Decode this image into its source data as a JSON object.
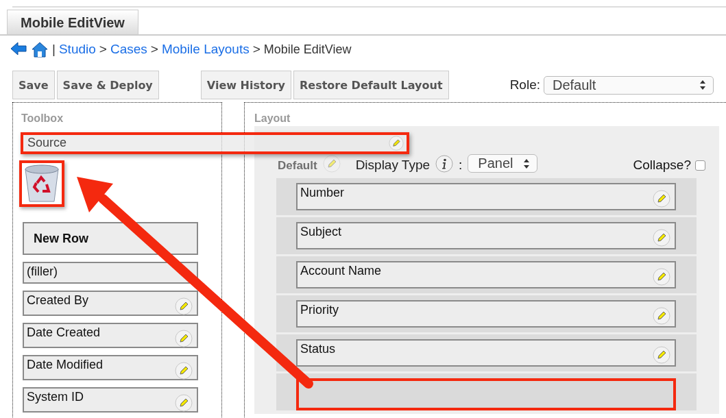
{
  "tab": {
    "label": "Mobile EditView",
    "selected": true
  },
  "breadcrumb": [
    {
      "kind": "separator",
      "text": "|"
    },
    {
      "kind": "link",
      "text": "Studio"
    },
    {
      "kind": "separator",
      "text": ">"
    },
    {
      "kind": "link",
      "text": "Cases"
    },
    {
      "kind": "separator",
      "text": ">"
    },
    {
      "kind": "link",
      "text": "Mobile Layouts"
    },
    {
      "kind": "separator",
      "text": ">"
    },
    {
      "kind": "current",
      "text": "Mobile EditView"
    }
  ],
  "toolbar": {
    "buttons": [
      {
        "label": "Save"
      },
      {
        "label": "Save & Deploy"
      },
      {
        "label": "View History"
      },
      {
        "label": "Restore Default Layout"
      }
    ],
    "role_label": "Role:",
    "role_value": "Default"
  },
  "toolbox": {
    "title": "Toolbox",
    "dragged_field": "Source",
    "new_row": "New Row",
    "fields": [
      {
        "label": "(filler)",
        "editable": false
      },
      {
        "label": "Created By",
        "editable": true
      },
      {
        "label": "Date Created",
        "editable": true
      },
      {
        "label": "Date Modified",
        "editable": true
      },
      {
        "label": "System ID",
        "editable": true
      }
    ]
  },
  "layout": {
    "title": "Layout",
    "panel_name": "Default",
    "display_type_label": "Display Type",
    "separator": ":",
    "display_type": "Panel",
    "collapse_label": "Collapse?",
    "collapse_checked": false,
    "rows": [
      {
        "kind": "field",
        "label": "Number"
      },
      {
        "kind": "field",
        "label": "Subject"
      },
      {
        "kind": "field",
        "label": "Account Name"
      },
      {
        "kind": "field",
        "label": "Priority"
      },
      {
        "kind": "field",
        "label": "Status"
      },
      {
        "kind": "empty"
      }
    ]
  }
}
